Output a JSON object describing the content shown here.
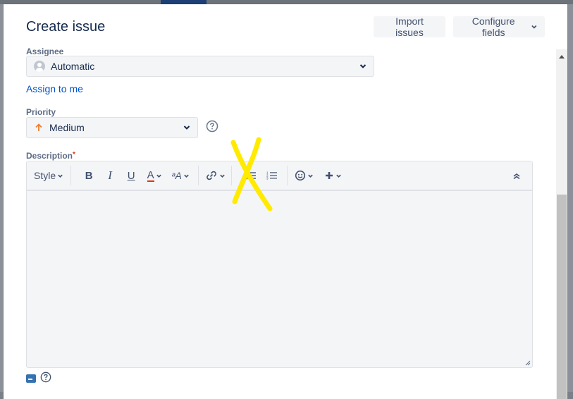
{
  "modal": {
    "title": "Create issue",
    "import_label": "Import issues",
    "configure_label": "Configure fields"
  },
  "assignee": {
    "label": "Assignee",
    "value": "Automatic",
    "assign_to_me": "Assign to me"
  },
  "priority": {
    "label": "Priority",
    "value": "Medium",
    "icon": "arrow-up-icon",
    "icon_color": "#e97f33"
  },
  "description": {
    "label": "Description",
    "required_mark": "*",
    "toolbar": {
      "style_label": "Style",
      "bold_label": "B",
      "italic_label": "I",
      "underline_label": "U",
      "color_label": "A",
      "more_formatting_label": "ᵃA"
    }
  },
  "annotation": {
    "mark": "yellow-x-icon",
    "color": "#ffea00"
  },
  "colors": {
    "link": "#0052cc",
    "required": "#de350b",
    "field_bg": "#f4f5f7"
  }
}
